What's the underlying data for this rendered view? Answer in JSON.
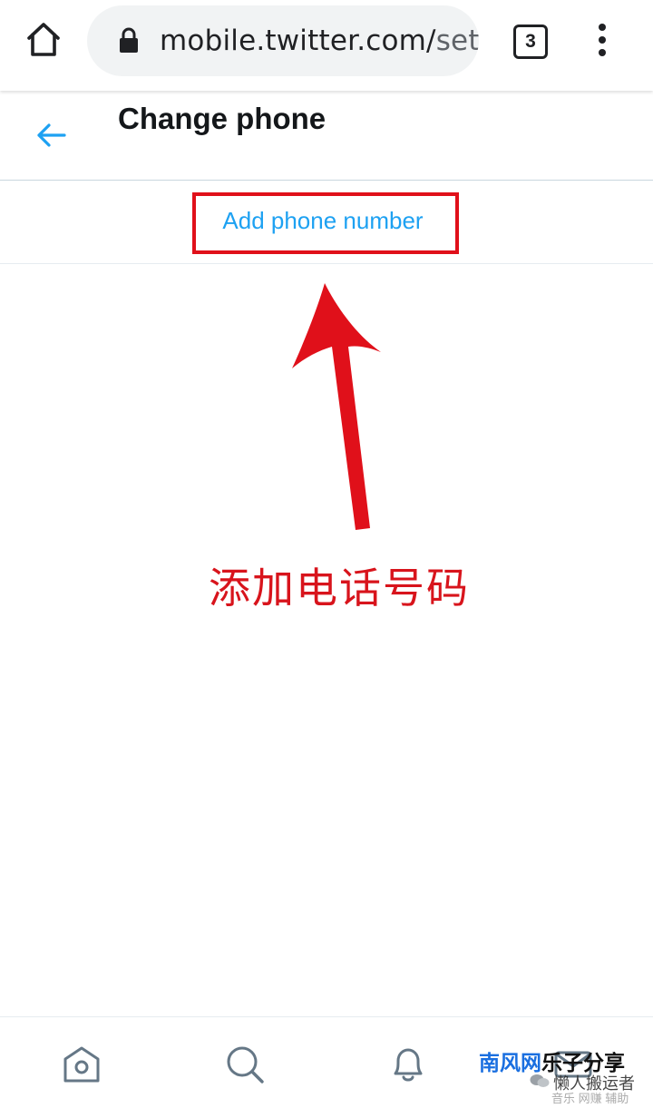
{
  "browser": {
    "url_host": "mobile.twitter.com/",
    "url_path": "sett",
    "tab_count": "3",
    "icons": [
      "home-icon",
      "lock-icon",
      "more-vertical-icon"
    ]
  },
  "header": {
    "title": "Change phone",
    "back_icon": "arrow-left-icon"
  },
  "main": {
    "add_phone_label": "Add phone number",
    "annotation_text": "添加电话号码"
  },
  "bottom_nav": {
    "items": [
      "home-icon",
      "search-icon",
      "notifications-icon",
      "messages-icon"
    ]
  },
  "watermark": {
    "brand_blue": "南风网",
    "brand_black": "乐子分享",
    "line2": "懒人搬运者",
    "line3": "音乐 网赚 辅助"
  },
  "colors": {
    "accent": "#1da1f2",
    "annotation_red": "#e0101a",
    "title_text": "#14171a"
  }
}
